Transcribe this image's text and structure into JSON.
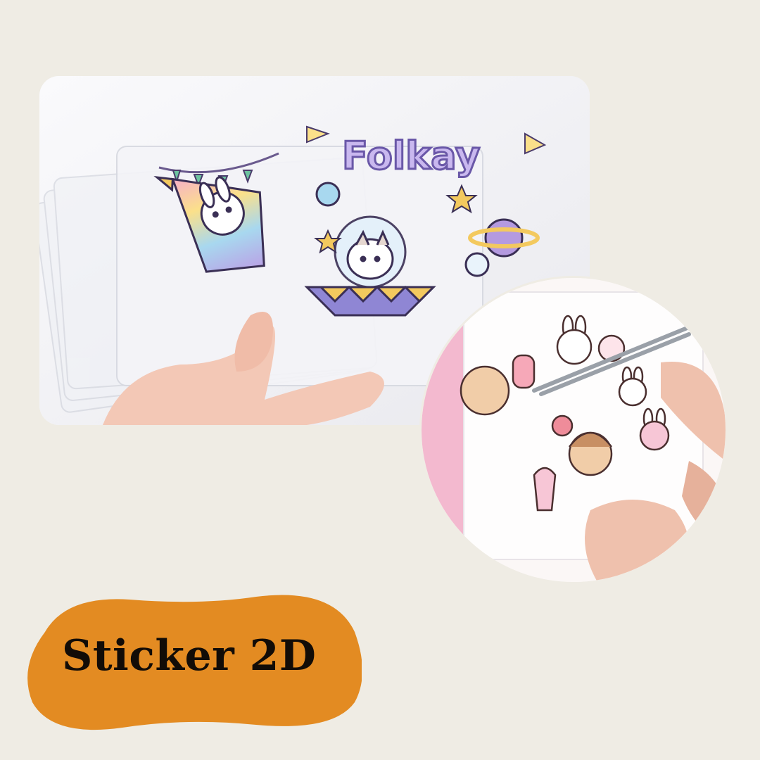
{
  "title": "Sticker 2D",
  "product_photo": {
    "sticker_brand_text": "Folkay",
    "description_icons": [
      "rocket-sticker-icon",
      "ufo-cat-sticker-icon",
      "planet-sticker-icon",
      "star-icon"
    ]
  },
  "detail_photo": {
    "description_icons": [
      "bunny-sticker-icon",
      "girl-sticker-icon",
      "tweezers-icon"
    ]
  },
  "colors": {
    "background": "#efece4",
    "title_badge": "#e38b22",
    "title_text": "#120c07"
  }
}
